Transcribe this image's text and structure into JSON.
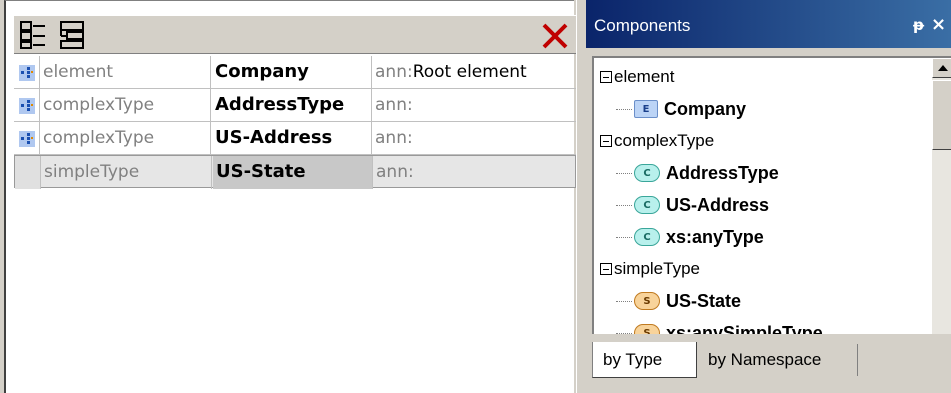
{
  "toolbar": {
    "tree_icon_1": "tree-view-icon",
    "tree_icon_2": "tree-expand-icon",
    "close_icon": "close-icon"
  },
  "rows": [
    {
      "kind": "element",
      "name": "Company",
      "ann_prefix": "ann:",
      "ann_value": "Root element",
      "icon": "node-icon"
    },
    {
      "kind": "complexType",
      "name": "AddressType",
      "ann_prefix": "ann:",
      "ann_value": "",
      "icon": "node-icon"
    },
    {
      "kind": "complexType",
      "name": "US-Address",
      "ann_prefix": "ann:",
      "ann_value": "",
      "icon": "node-icon"
    },
    {
      "kind": "simpleType",
      "name": "US-State",
      "ann_prefix": "ann:",
      "ann_value": "",
      "icon": ""
    }
  ],
  "components": {
    "title": "Components",
    "pin_icon": "pin-icon",
    "close_glyph": "×",
    "tree": {
      "groups": [
        {
          "label": "element",
          "items": [
            {
              "badge": "E",
              "name": "Company"
            }
          ]
        },
        {
          "label": "complexType",
          "items": [
            {
              "badge": "C",
              "name": "AddressType"
            },
            {
              "badge": "C",
              "name": "US-Address"
            },
            {
              "badge": "C",
              "name": "xs:anyType"
            }
          ]
        },
        {
          "label": "simpleType",
          "items": [
            {
              "badge": "S",
              "name": "US-State"
            },
            {
              "badge": "S",
              "name": "xs:anySimpleType"
            }
          ]
        }
      ]
    },
    "tabs": [
      {
        "label": "by Type",
        "active": true
      },
      {
        "label": "by Namespace",
        "active": false
      }
    ]
  },
  "colors": {
    "title_bar_start": "#0a246a",
    "title_bar_end": "#3a6ea5",
    "close_red": "#c00000"
  }
}
